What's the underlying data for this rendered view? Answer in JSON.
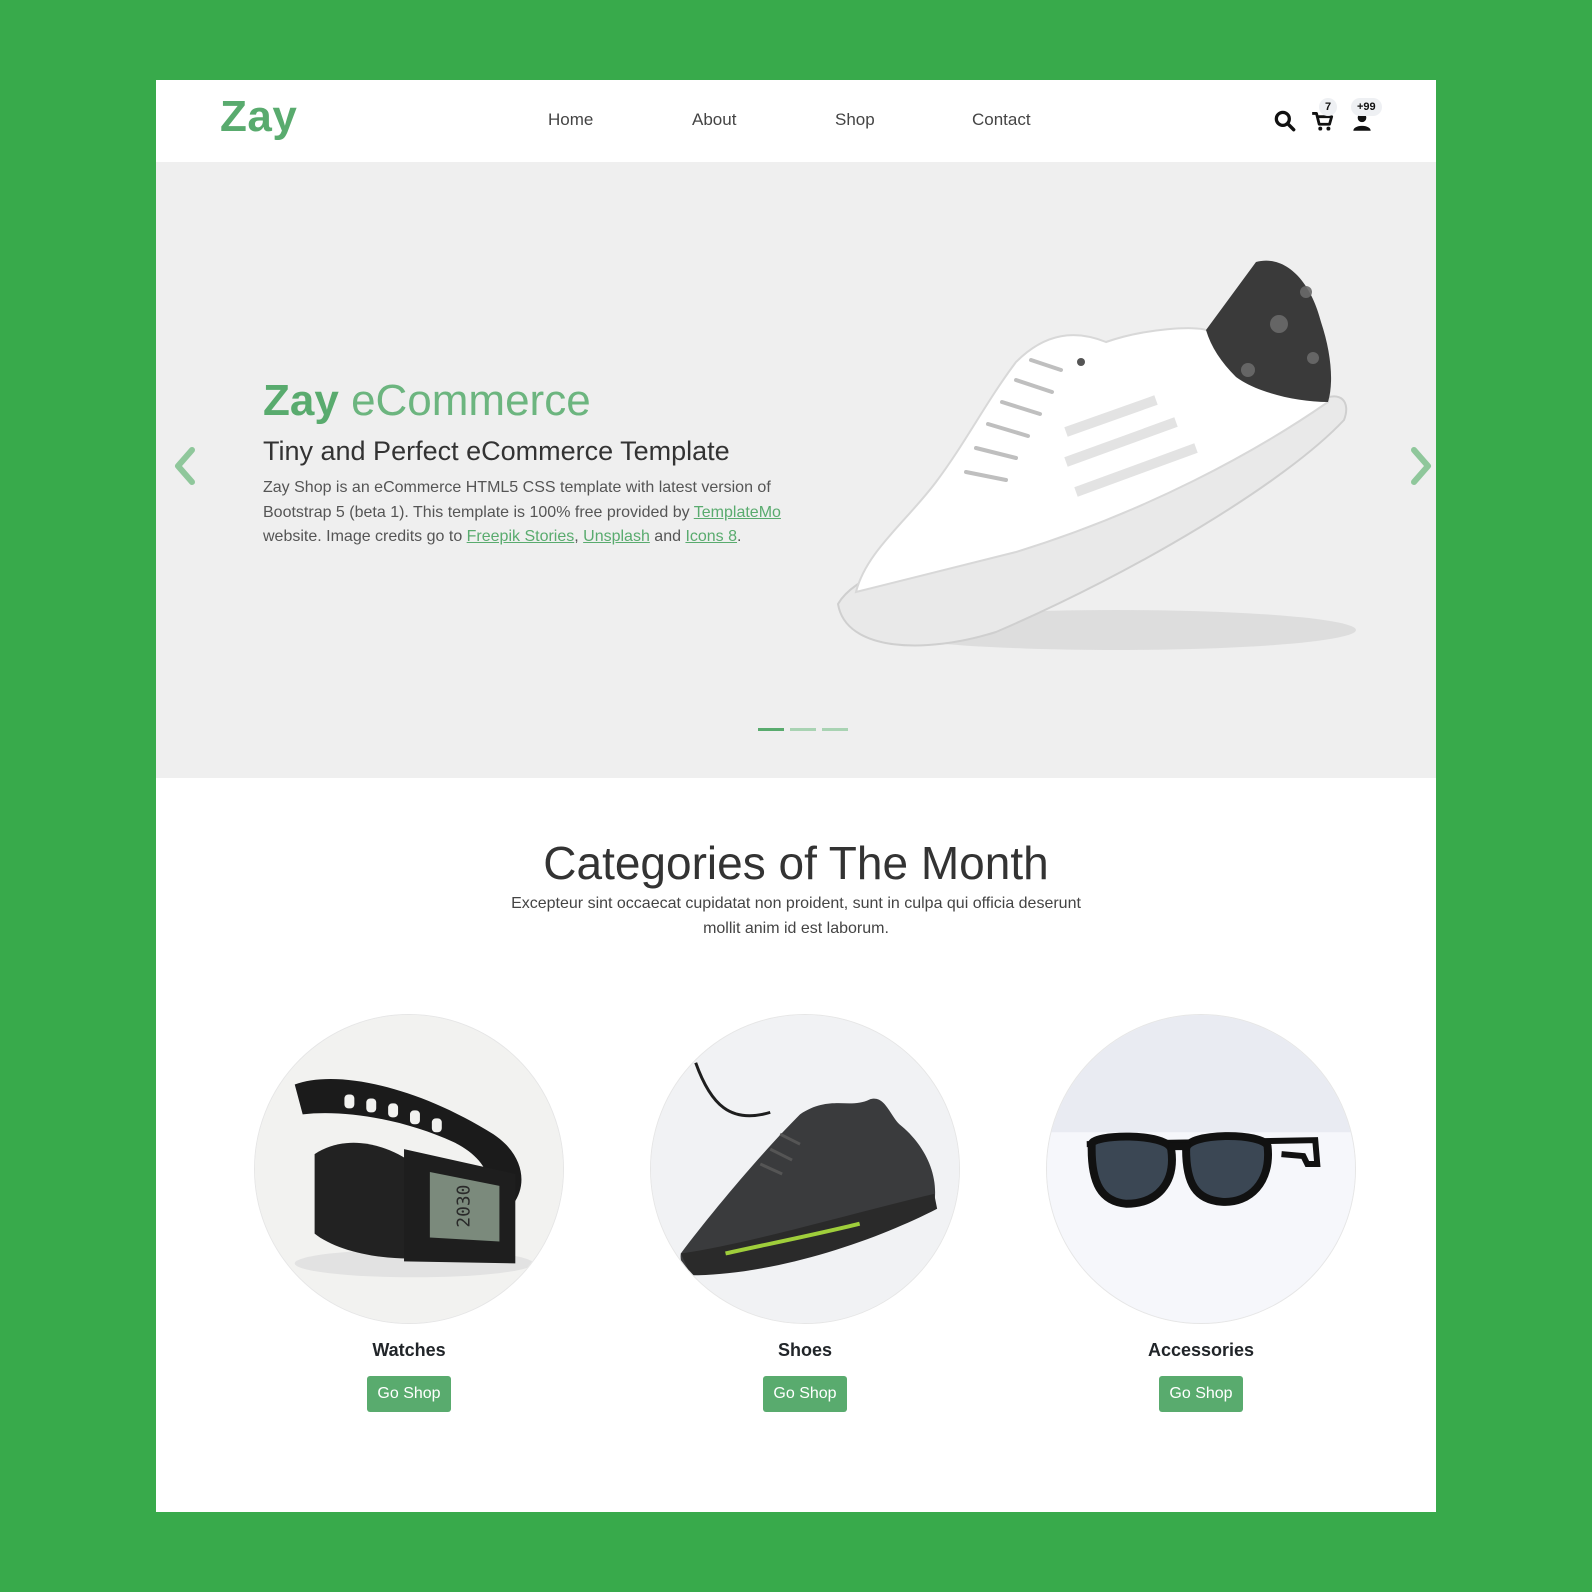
{
  "brand": {
    "logo": "Zay",
    "color": "#59ab6e"
  },
  "nav": {
    "home": "Home",
    "about": "About",
    "shop": "Shop",
    "contact": "Contact"
  },
  "header_icons": {
    "search": "search-icon",
    "cart": "cart-icon",
    "user": "user-icon",
    "cart_badge": "7",
    "user_badge": "+99"
  },
  "hero": {
    "title_bold": "Zay",
    "title_light": "eCommerce",
    "subtitle": "Tiny and Perfect eCommerce Template",
    "text_part1": "Zay Shop is an eCommerce HTML5 CSS template with latest version of Bootstrap 5 (beta 1). This template is 100% free provided by ",
    "link_templatemo": "TemplateMo",
    "text_part2": " website. Image credits go to ",
    "link_freepik": "Freepik Stories",
    "text_sep": ", ",
    "link_unsplash": "Unsplash",
    "text_and": " and ",
    "link_icons8": "Icons 8",
    "text_end": ".",
    "slide_count": 3,
    "active_slide": 1
  },
  "categories": {
    "title": "Categories of The Month",
    "description": "Excepteur sint occaecat cupidatat non proident, sunt in culpa qui officia deserunt mollit anim id est laborum.",
    "items": [
      {
        "name": "Watches",
        "button": "Go Shop"
      },
      {
        "name": "Shoes",
        "button": "Go Shop"
      },
      {
        "name": "Accessories",
        "button": "Go Shop"
      }
    ]
  },
  "colors": {
    "page_bg": "#38aa4b",
    "accent": "#59ab6e",
    "hero_bg": "#efefef"
  }
}
